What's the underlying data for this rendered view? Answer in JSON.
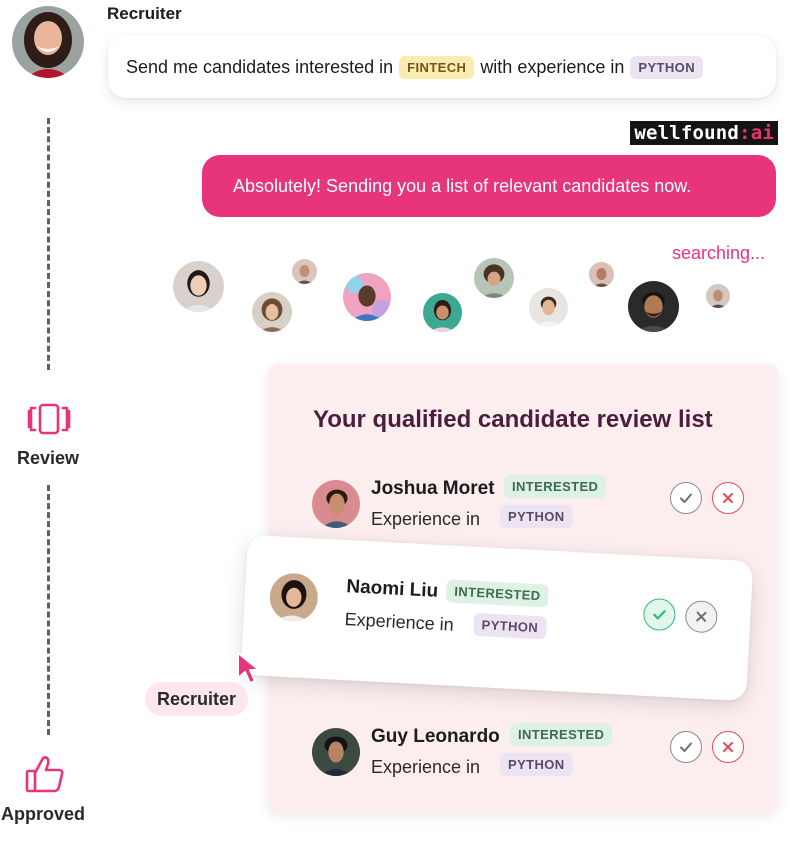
{
  "chat": {
    "recruiter_label": "Recruiter",
    "request": {
      "text_before": "Send me candidates interested in",
      "tag_interest": "FINTECH",
      "text_middle": "with experience in",
      "tag_skill": "PYTHON"
    },
    "logo": {
      "brand": "wellfound",
      "suffix": ":ai"
    },
    "reply": "Absolutely! Sending you a list of relevant candidates now.",
    "status": "searching..."
  },
  "timeline": {
    "review_label": "Review",
    "approved_label": "Approved"
  },
  "review_list": {
    "title": "Your qualified candidate review list",
    "candidates": [
      {
        "name": "Joshua Moret",
        "status": "INTERESTED",
        "experience_label": "Experience in",
        "skill": "PYTHON",
        "decision": "none"
      },
      {
        "name": "Naomi Liu",
        "status": "INTERESTED",
        "experience_label": "Experience in",
        "skill": "PYTHON",
        "decision": "approved"
      },
      {
        "name": "Guy Leonardo",
        "status": "INTERESTED",
        "experience_label": "Experience in",
        "skill": "PYTHON",
        "decision": "none"
      }
    ]
  },
  "cursor": {
    "label": "Recruiter"
  },
  "colors": {
    "accent_pink": "#e8347a",
    "title_plum": "#4d1d3d",
    "card_bg": "#fcedef",
    "approve_green": "#2dbb7a",
    "reject_red": "#e44a5f"
  },
  "icons": [
    "review-cards-icon",
    "thumbs-up-icon",
    "check-icon",
    "close-icon",
    "cursor-arrow-icon"
  ]
}
